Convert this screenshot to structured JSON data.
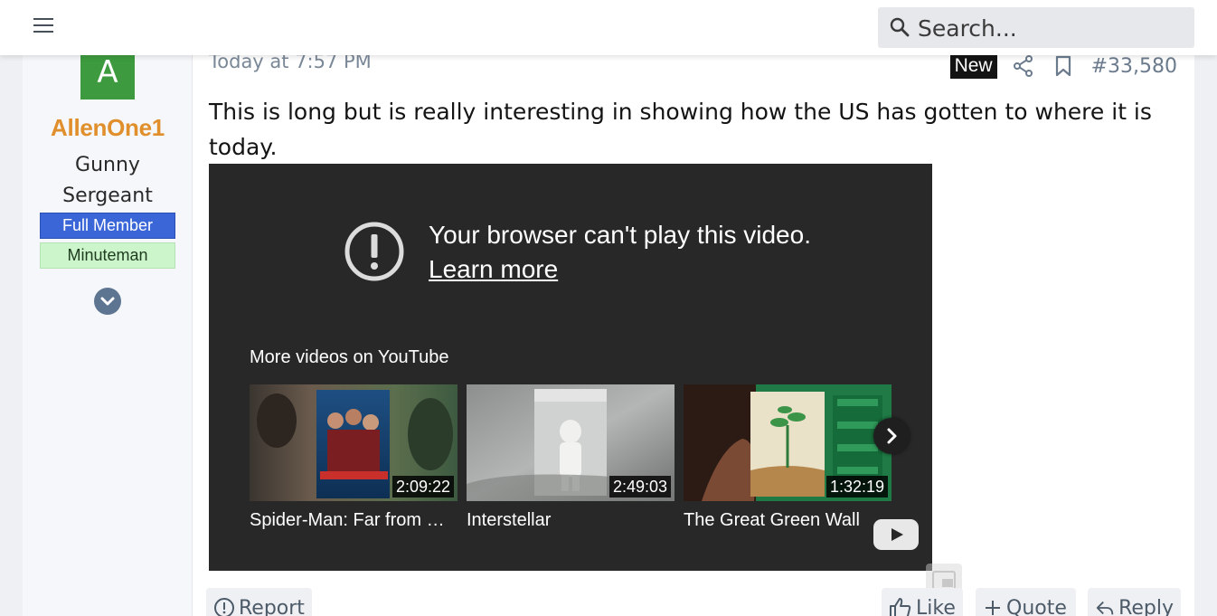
{
  "topbar": {
    "menu_icon": "hamburger-menu-icon",
    "search_placeholder": "Search..."
  },
  "author": {
    "avatar_letter": "A",
    "avatar_color": "#3d9a3e",
    "username": "AllenOne1",
    "username_color": "#e08f2c",
    "title_line1": "Gunny",
    "title_line2": "Sergeant",
    "banners": [
      {
        "label": "Full Member",
        "bg": "#3b66d8"
      },
      {
        "label": "Minuteman",
        "bg": "#ccf5cc"
      }
    ]
  },
  "post": {
    "timestamp": "Today at 7:57 PM",
    "new_badge": "New",
    "post_number": "#33,580",
    "message": "This is long but is really interesting in showing how the US has gotten to where it is today."
  },
  "video": {
    "error_line": "Your browser can't play this video.",
    "learn_more": "Learn more",
    "more_title": "More videos on YouTube",
    "items": [
      {
        "title": "Spider-Man: Far from H...",
        "duration": "2:09:22"
      },
      {
        "title": "Interstellar",
        "duration": "2:49:03"
      },
      {
        "title": "The Great Green Wall",
        "duration": "1:32:19"
      }
    ]
  },
  "actions": {
    "report": "Report",
    "like": "Like",
    "quote": "Quote",
    "reply": "Reply"
  }
}
